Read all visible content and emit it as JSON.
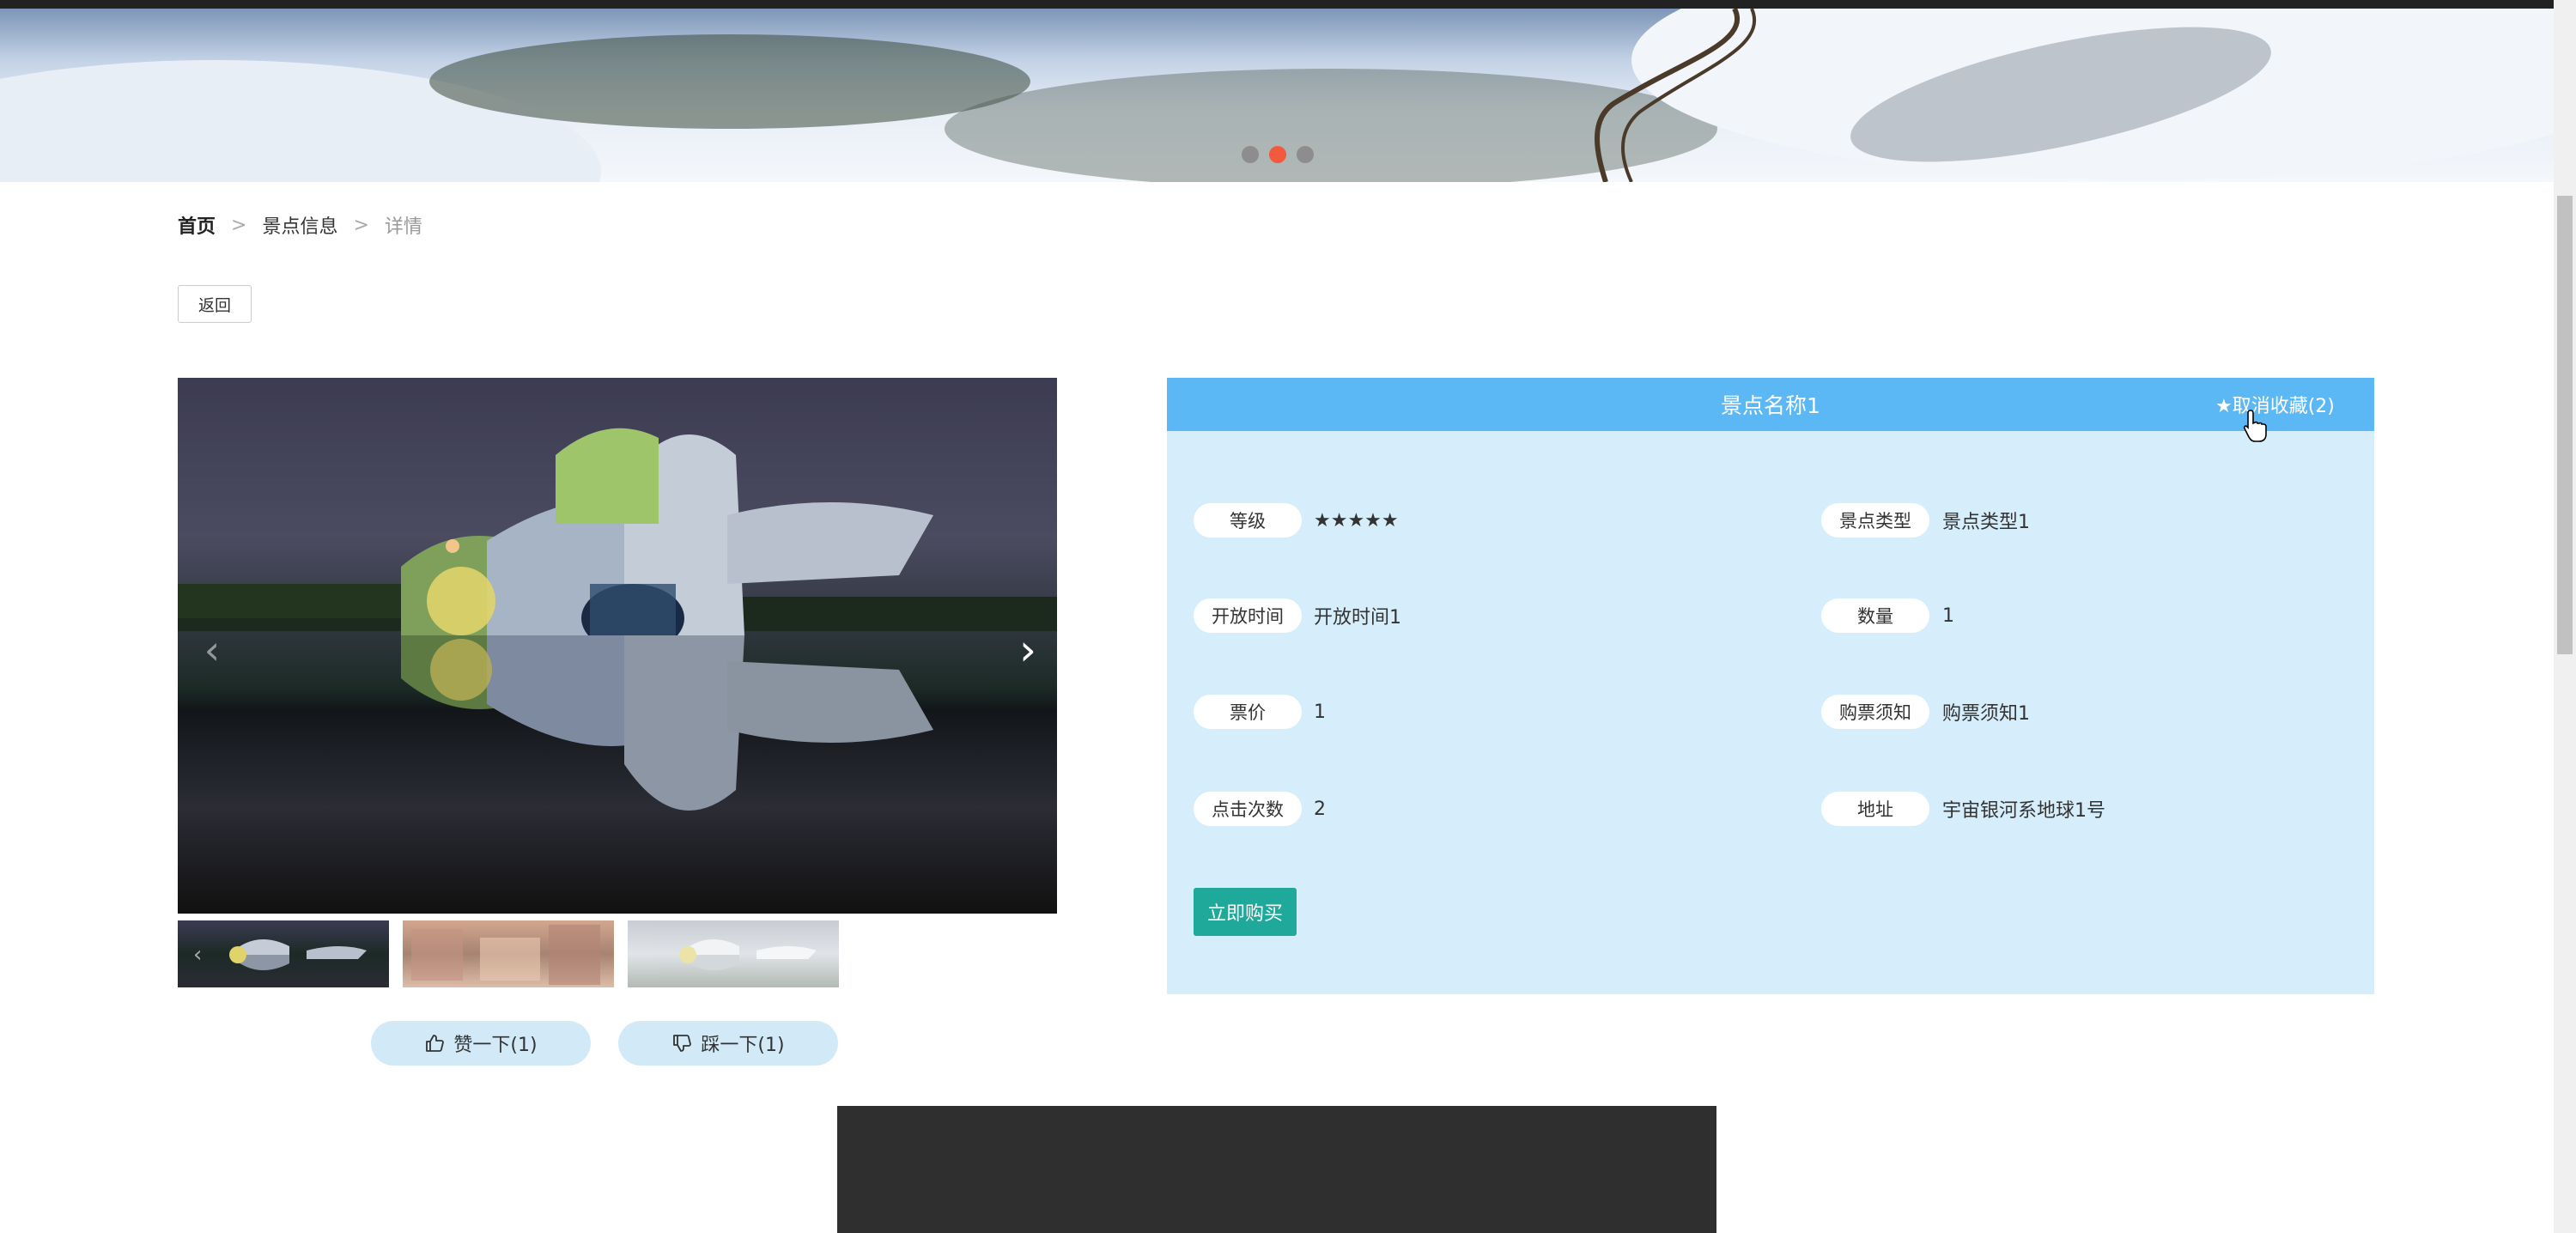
{
  "breadcrumb": {
    "home": "首页",
    "sep1": ">",
    "section": "景点信息",
    "sep2": ">",
    "current": "详情"
  },
  "back_button": "返回",
  "banner": {
    "active_dot": 2,
    "dot_count": 3,
    "accent": "#f15a3c"
  },
  "gallery": {
    "thumbnail_count": 3,
    "selected": 1
  },
  "votes": {
    "like": "赞一下(1)",
    "dislike": "踩一下(1)"
  },
  "detail": {
    "title": "景点名称1",
    "favorite": "★取消收藏(2)",
    "fields": [
      {
        "label": "等级",
        "value": "★★★★★"
      },
      {
        "label": "景点类型",
        "value": "景点类型1"
      },
      {
        "label": "开放时间",
        "value": "开放时间1"
      },
      {
        "label": "数量",
        "value": "1"
      },
      {
        "label": "票价",
        "value": "1"
      },
      {
        "label": "购票须知",
        "value": "购票须知1"
      },
      {
        "label": "点击次数",
        "value": "2"
      },
      {
        "label": "地址",
        "value": "宇宙银河系地球1号"
      }
    ],
    "buy_button": "立即购买"
  },
  "colors": {
    "header": "#5cb8f5",
    "panel": "#d6edfb",
    "buy": "#1ea99b",
    "vote": "#d2e9f7"
  }
}
